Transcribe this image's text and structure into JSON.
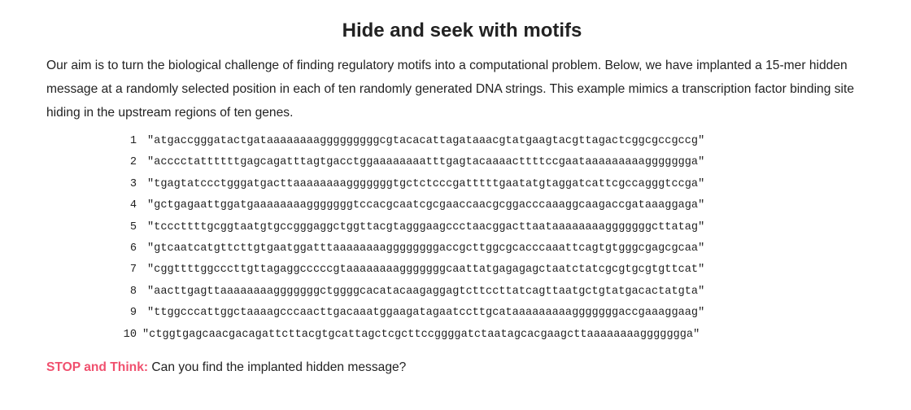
{
  "title": "Hide and seek with motifs",
  "intro": "Our aim is to turn the biological challenge of finding regulatory motifs into a computational problem. Below, we have implanted a 15-mer hidden message at a randomly selected position in each of ten randomly generated DNA strings. This example mimics a transcription factor binding site hiding in the upstream regions of ten genes.",
  "sequences": [
    {
      "num": "1",
      "seq": "\"atgaccgggatactgataaaaaaaagggggggggcgtacacattagataaacgtatgaagtacgttagactcggcgccgccg\""
    },
    {
      "num": "2",
      "seq": "\"acccctattttttgagcagatttagtgacctggaaaaaaaatttgagtacaaaacttttccgaataaaaaaaaaggggggga\""
    },
    {
      "num": "3",
      "seq": "\"tgagtatccctgggatgacttaaaaaaaagggggggtgctctcccgatttttgaatatgtaggatcattcgccagggtccga\""
    },
    {
      "num": "4",
      "seq": "\"gctgagaattggatgaaaaaaaagggggggtccacgcaatcgcgaaccaacgcggacccaaaggcaagaccgataaaggaga\""
    },
    {
      "num": "5",
      "seq": "\"tcccttttgcggtaatgtgccgggaggctggttacgtagggaagccctaacggacttaataaaaaaaagggggggcttatag\""
    },
    {
      "num": "6",
      "seq": "\"gtcaatcatgttcttgtgaatggatttaaaaaaaaggggggggaccgcttggcgcacccaaattcagtgtgggcgagcgcaa\""
    },
    {
      "num": "7",
      "seq": "\"cggttttggcccttgttagaggcccccgtaaaaaaaagggggggcaattatgagagagctaatctatcgcgtgcgtgttcat\""
    },
    {
      "num": "8",
      "seq": "\"aacttgagttaaaaaaaagggggggctggggcacatacaagaggagtcttccttatcagttaatgctgtatgacactatgta\""
    },
    {
      "num": "9",
      "seq": "\"ttggcccattggctaaaagcccaacttgacaaatggaagatagaatccttgcataaaaaaaaagggggggaccgaaaggaag\""
    },
    {
      "num": "10",
      "seq": "\"ctggtgagcaacgacagattcttacgtgcattagctcgcttccggggatctaatagcacgaagcttaaaaaaaaggggggga\""
    }
  ],
  "stop_label": "STOP and Think:",
  "stop_text": " Can you find the implanted hidden message?",
  "colors": {
    "stop_label": "#f0506e",
    "text": "#222222"
  }
}
